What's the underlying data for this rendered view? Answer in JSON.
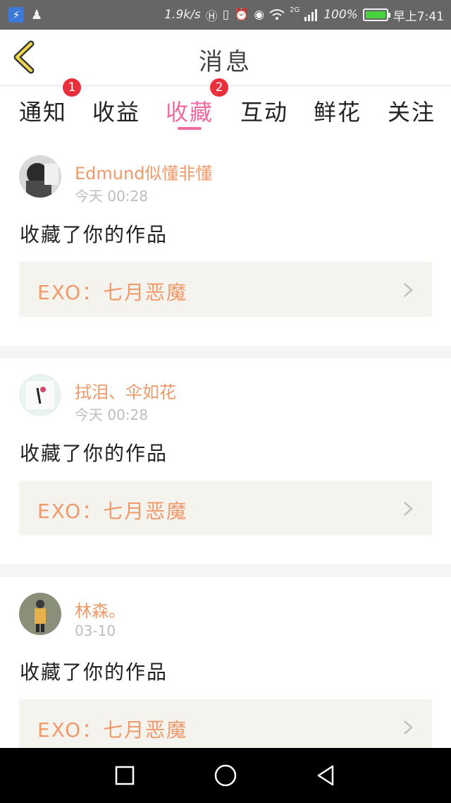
{
  "status_bar": {
    "speed": "1.9k/s",
    "network": "2G",
    "battery_percent": "100%",
    "battery_level": 1.0,
    "time": "早上7:41"
  },
  "header": {
    "title": "消息"
  },
  "tabs": [
    {
      "label": "通知",
      "badge": "1"
    },
    {
      "label": "收益",
      "badge": ""
    },
    {
      "label": "收藏",
      "badge": "2",
      "active": true
    },
    {
      "label": "互动",
      "badge": ""
    },
    {
      "label": "鲜花",
      "badge": ""
    },
    {
      "label": "关注",
      "badge": ""
    }
  ],
  "messages": [
    {
      "user": "Edmund似懂非懂",
      "time": "今天 00:28",
      "action": "收藏了你的作品",
      "work": "EXO：七月恶魔"
    },
    {
      "user": "拭泪、伞如花",
      "time": "今天 00:28",
      "action": "收藏了你的作品",
      "work": "EXO：七月恶魔"
    },
    {
      "user": "林森。",
      "time": "03-10",
      "action": "收藏了你的作品",
      "work": "EXO：七月恶魔"
    }
  ],
  "colors": {
    "accent_pink": "#ee6aa0",
    "name_orange": "#ee9a6a",
    "badge_red": "#e8303d",
    "card_bg": "#f4f3ee"
  },
  "icons": {
    "back": "chevron-left-icon",
    "card": "chevron-right-icon",
    "nav_recent": "square-icon",
    "nav_home": "circle-icon",
    "nav_back": "triangle-back-icon"
  }
}
